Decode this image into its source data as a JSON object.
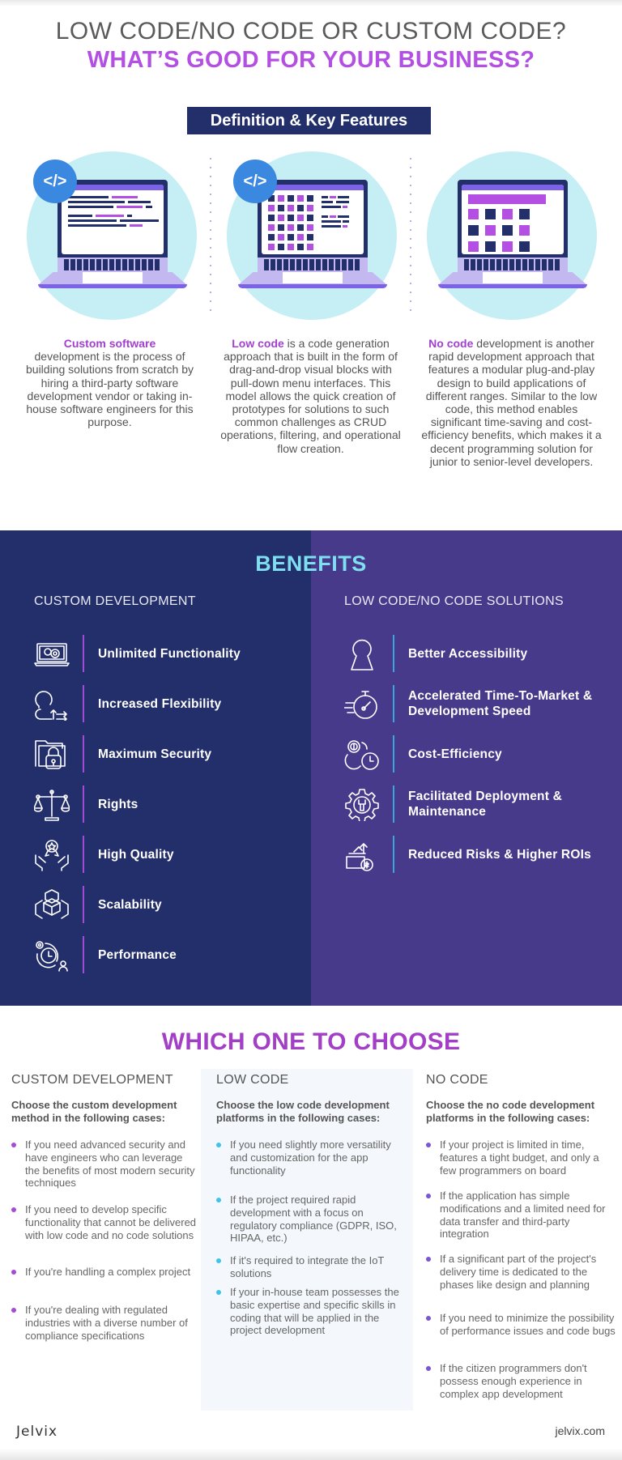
{
  "header": {
    "title_line1": "LOW CODE/NO CODE OR CUSTOM CODE?",
    "title_line2": "WHAT’S GOOD FOR YOUR BUSINESS?",
    "section_badge": "Definition & Key Features"
  },
  "definitions": [
    {
      "illustration": "laptop-code-editor",
      "badge_icon": "</>",
      "term": "Custom software",
      "text": " development is the process of building solutions from scratch by hiring a third-party software development vendor or taking in-house software engineers for this purpose."
    },
    {
      "illustration": "laptop-blocks-and-code",
      "badge_icon": "</>",
      "term": "Low code",
      "text": " is a code generation approach that is built in the form of drag-and-drop visual blocks with pull-down menu interfaces. This model allows the quick creation of prototypes for solutions to such common challenges as CRUD operations, filtering, and operational flow creation."
    },
    {
      "illustration": "laptop-blocks",
      "badge_icon": "",
      "term": "No code",
      "text": " development is another rapid development approach that features a modular plug-and-play design to build applications of different ranges. Similar to the low code, this method enables significant time-saving and cost-efficiency benefits, which makes it a decent programming solution for junior to senior-level developers."
    }
  ],
  "benefits": {
    "title": "BENEFITS",
    "custom": {
      "heading": "CUSTOM DEVELOPMENT",
      "items": [
        {
          "icon": "laptop-gears-icon",
          "label": "Unlimited Functionality"
        },
        {
          "icon": "flexible-arrows-icon",
          "label": "Increased Flexibility"
        },
        {
          "icon": "folder-lock-icon",
          "label": "Maximum Security"
        },
        {
          "icon": "scales-icon",
          "label": "Rights"
        },
        {
          "icon": "hands-award-icon",
          "label": "High Quality"
        },
        {
          "icon": "cubes-icon",
          "label": "Scalability"
        },
        {
          "icon": "clock-gear-user-icon",
          "label": "Performance"
        }
      ]
    },
    "lowcode": {
      "heading": "LOW CODE/NO CODE SOLUTIONS",
      "items": [
        {
          "icon": "keyhole-icon",
          "label": "Better Accessibility"
        },
        {
          "icon": "stopwatch-speed-icon",
          "label": "Accelerated Time-To-Market & Development Speed"
        },
        {
          "icon": "gear-dollar-clock-icon",
          "label": "Cost-Efficiency"
        },
        {
          "icon": "gear-wrench-icon",
          "label": "Facilitated Deployment & Maintenance"
        },
        {
          "icon": "money-growth-icon",
          "label": "Reduced Risks & Higher ROIs"
        }
      ]
    }
  },
  "which": {
    "title": "WHICH ONE TO CHOOSE",
    "columns": [
      {
        "heading": "CUSTOM DEVELOPMENT",
        "subheading": "Choose the custom development method in the following cases:",
        "bullet_color": "#a14bd6",
        "items": [
          "If you need advanced security and have engineers who can leverage the benefits of most modern security techniques",
          "If you need to develop specific functionality that cannot be delivered with low code and no code solutions",
          "If you're handling a complex project",
          "If you're dealing with regulated industries with a diverse number of compliance specifications"
        ]
      },
      {
        "heading": "LOW CODE",
        "subheading": "Choose the low code development platforms in the following cases:",
        "bullet_color": "#3fc3e8",
        "items": [
          "If you need slightly more versatility and customization for the app functionality",
          "If the project required rapid development with a focus on regulatory compliance (GDPR, ISO, HIPAA, etc.)",
          "If it's required to integrate the IoT solutions",
          "If your in-house team possesses the basic expertise and specific skills in coding that will be applied in the project development"
        ]
      },
      {
        "heading": "NO CODE",
        "subheading": "Choose the no code development platforms in the following cases:",
        "bullet_color": "#7b55d6",
        "items": [
          "If your project is limited in time, features a tight budget, and only a few programmers on board",
          "If the application has simple modifications and a limited need for data transfer and third-party integration",
          "If a significant part of the project's delivery time is dedicated to the phases like design and planning",
          "If you need to minimize the possibility of performance issues and code bugs",
          "If the citizen programmers don't possess enough experience in complex app development"
        ]
      }
    ]
  },
  "footer": {
    "brand": "Jelvix",
    "site": "jelvix.com"
  },
  "colors": {
    "title_purple": "#b44fe3",
    "navy": "#232f6b",
    "indigo": "#473a8b",
    "cyan_title": "#7ddff0",
    "code_badge_blue": "#3b88e0",
    "circle_bg": "#c6eff5"
  }
}
